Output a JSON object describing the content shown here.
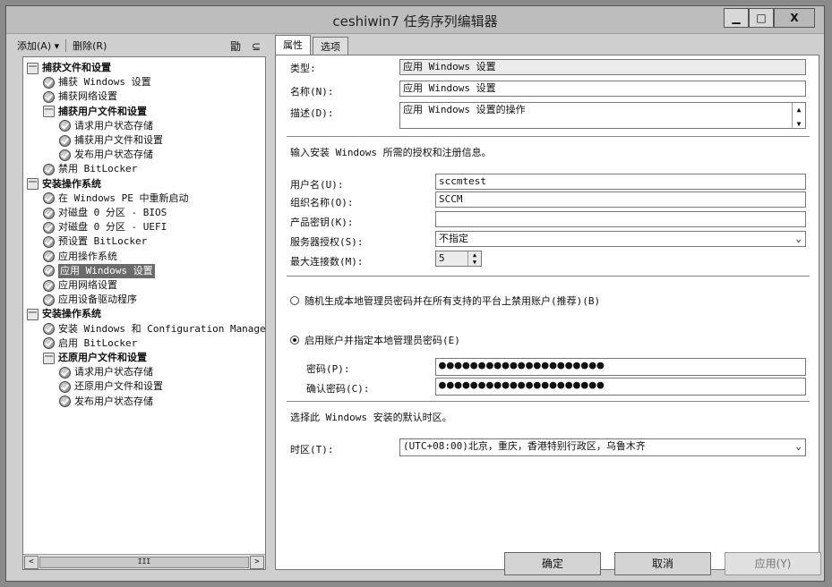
{
  "window": {
    "title": "ceshiwin7 任务序列编辑器",
    "min": "▁",
    "max": "□",
    "close": "X"
  },
  "toolbar": {
    "add": "添加(A) ▾",
    "remove": "删除(R)",
    "icons": "勖 ⊆"
  },
  "tree": [
    {
      "label": "捕获文件和设置",
      "type": "group",
      "level": 0
    },
    {
      "label": "捕获 Windows 设置",
      "type": "step",
      "level": 1
    },
    {
      "label": "捕获网络设置",
      "type": "step",
      "level": 1
    },
    {
      "label": "捕获用户文件和设置",
      "type": "group",
      "level": 1
    },
    {
      "label": "请求用户状态存储",
      "type": "step",
      "level": 2
    },
    {
      "label": "捕获用户文件和设置",
      "type": "step",
      "level": 2
    },
    {
      "label": "发布用户状态存储",
      "type": "step",
      "level": 2
    },
    {
      "label": "禁用 BitLocker",
      "type": "step",
      "level": 1
    },
    {
      "label": "安装操作系统",
      "type": "group",
      "level": 0
    },
    {
      "label": "在 Windows PE 中重新启动",
      "type": "step",
      "level": 1
    },
    {
      "label": "对磁盘 0 分区 - BIOS",
      "type": "step",
      "level": 1
    },
    {
      "label": "对磁盘 0 分区 - UEFI",
      "type": "step",
      "level": 1
    },
    {
      "label": "预设置 BitLocker",
      "type": "step",
      "level": 1
    },
    {
      "label": "应用操作系统",
      "type": "step",
      "level": 1
    },
    {
      "label": "应用 Windows 设置",
      "type": "step",
      "level": 1,
      "selected": true
    },
    {
      "label": "应用网络设置",
      "type": "step",
      "level": 1
    },
    {
      "label": "应用设备驱动程序",
      "type": "step",
      "level": 1
    },
    {
      "label": "安装操作系统",
      "type": "group",
      "level": 0
    },
    {
      "label": "安装 Windows 和 Configuration Manager",
      "type": "step",
      "level": 1
    },
    {
      "label": "启用 BitLocker",
      "type": "step",
      "level": 1
    },
    {
      "label": "还原用户文件和设置",
      "type": "group",
      "level": 1
    },
    {
      "label": "请求用户状态存储",
      "type": "step",
      "level": 2
    },
    {
      "label": "还原用户文件和设置",
      "type": "step",
      "level": 2
    },
    {
      "label": "发布用户状态存储",
      "type": "step",
      "level": 2
    }
  ],
  "hscroll": {
    "left": "<",
    "right": ">",
    "thumb": "III"
  },
  "tabs": [
    "属性",
    "选项"
  ],
  "props": {
    "type_label": "类型:",
    "type_value": "应用 Windows 设置",
    "name_label": "名称(N):",
    "name_value": "应用 Windows 设置",
    "desc_label": "描述(D):",
    "desc_value": "应用 Windows 设置的操作",
    "section1": "输入安装 Windows 所需的授权和注册信息。",
    "username_label": "用户名(U):",
    "username_value": "sccmtest",
    "org_label": "组织名称(O):",
    "org_value": "SCCM",
    "key_label": "产品密钥(K):",
    "key_value": "",
    "license_label": "服务器授权(S):",
    "license_value": "不指定",
    "maxconn_label": "最大连接数(M):",
    "maxconn_value": "5",
    "radio1": "随机生成本地管理员密码并在所有支持的平台上禁用账户(推荐)(B)",
    "radio2": "启用账户并指定本地管理员密码(E)",
    "pw_label": "密码(P):",
    "pw_value": "●●●●●●●●●●●●●●●●●●●●●",
    "pw2_label": "确认密码(C):",
    "pw2_value": "●●●●●●●●●●●●●●●●●●●●●",
    "section2": "选择此 Windows 安装的默认时区。",
    "tz_label": "时区(T):",
    "tz_value": "(UTC+08:00)北京，重庆，香港特别行政区，乌鲁木齐"
  },
  "buttons": {
    "ok": "确定",
    "cancel": "取消",
    "apply": "应用(Y)"
  }
}
